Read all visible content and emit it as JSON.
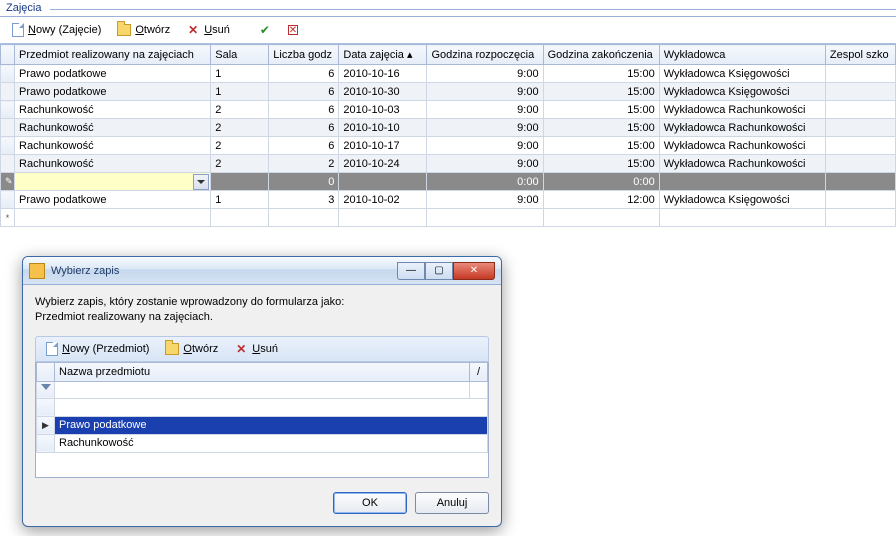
{
  "panel": {
    "title": "Zajęcia"
  },
  "toolbar": {
    "new_label": "Nowy (Zajęcie)",
    "open_label": "Otwórz",
    "delete_label": "Usuń"
  },
  "columns": {
    "c0": "Przedmiot realizowany na zajęciach",
    "c1": "Sala",
    "c2": "Liczba godz",
    "c3": "Data zajęcia ▴",
    "c4": "Godzina rozpoczęcia",
    "c5": "Godzina zakończenia",
    "c6": "Wykładowca",
    "c7": "Zespol szko"
  },
  "rows": [
    {
      "przedmiot": "Prawo podatkowe",
      "sala": "1",
      "godz": "6",
      "data": "2010-10-16",
      "start": "9:00",
      "end": "15:00",
      "wyk": "Wykładowca Księgowości"
    },
    {
      "przedmiot": "Prawo podatkowe",
      "sala": "1",
      "godz": "6",
      "data": "2010-10-30",
      "start": "9:00",
      "end": "15:00",
      "wyk": "Wykładowca Księgowości"
    },
    {
      "przedmiot": "Rachunkowość",
      "sala": "2",
      "godz": "6",
      "data": "2010-10-03",
      "start": "9:00",
      "end": "15:00",
      "wyk": "Wykładowca Rachunkowości"
    },
    {
      "przedmiot": "Rachunkowość",
      "sala": "2",
      "godz": "6",
      "data": "2010-10-10",
      "start": "9:00",
      "end": "15:00",
      "wyk": "Wykładowca Rachunkowości"
    },
    {
      "przedmiot": "Rachunkowość",
      "sala": "2",
      "godz": "6",
      "data": "2010-10-17",
      "start": "9:00",
      "end": "15:00",
      "wyk": "Wykładowca Rachunkowości"
    },
    {
      "przedmiot": "Rachunkowość",
      "sala": "2",
      "godz": "2",
      "data": "2010-10-24",
      "start": "9:00",
      "end": "15:00",
      "wyk": "Wykładowca Rachunkowości"
    }
  ],
  "editRow": {
    "godz": "0",
    "start": "0:00",
    "end": "0:00"
  },
  "lastRow": {
    "przedmiot": "Prawo podatkowe",
    "sala": "1",
    "godz": "3",
    "data": "2010-10-02",
    "start": "9:00",
    "end": "12:00",
    "wyk": "Wykładowca Księgowości"
  },
  "dialog": {
    "title": "Wybierz zapis",
    "line1": "Wybierz zapis, który zostanie wprowadzony do formularza jako:",
    "line2": "Przedmiot realizowany na zajęciach.",
    "toolbar": {
      "new_label": "Nowy (Przedmiot)",
      "open_label": "Otwórz",
      "delete_label": "Usuń"
    },
    "col": "Nazwa przedmiotu",
    "items": [
      "Prawo podatkowe",
      "Rachunkowość"
    ],
    "ok": "OK",
    "cancel": "Anuluj"
  }
}
